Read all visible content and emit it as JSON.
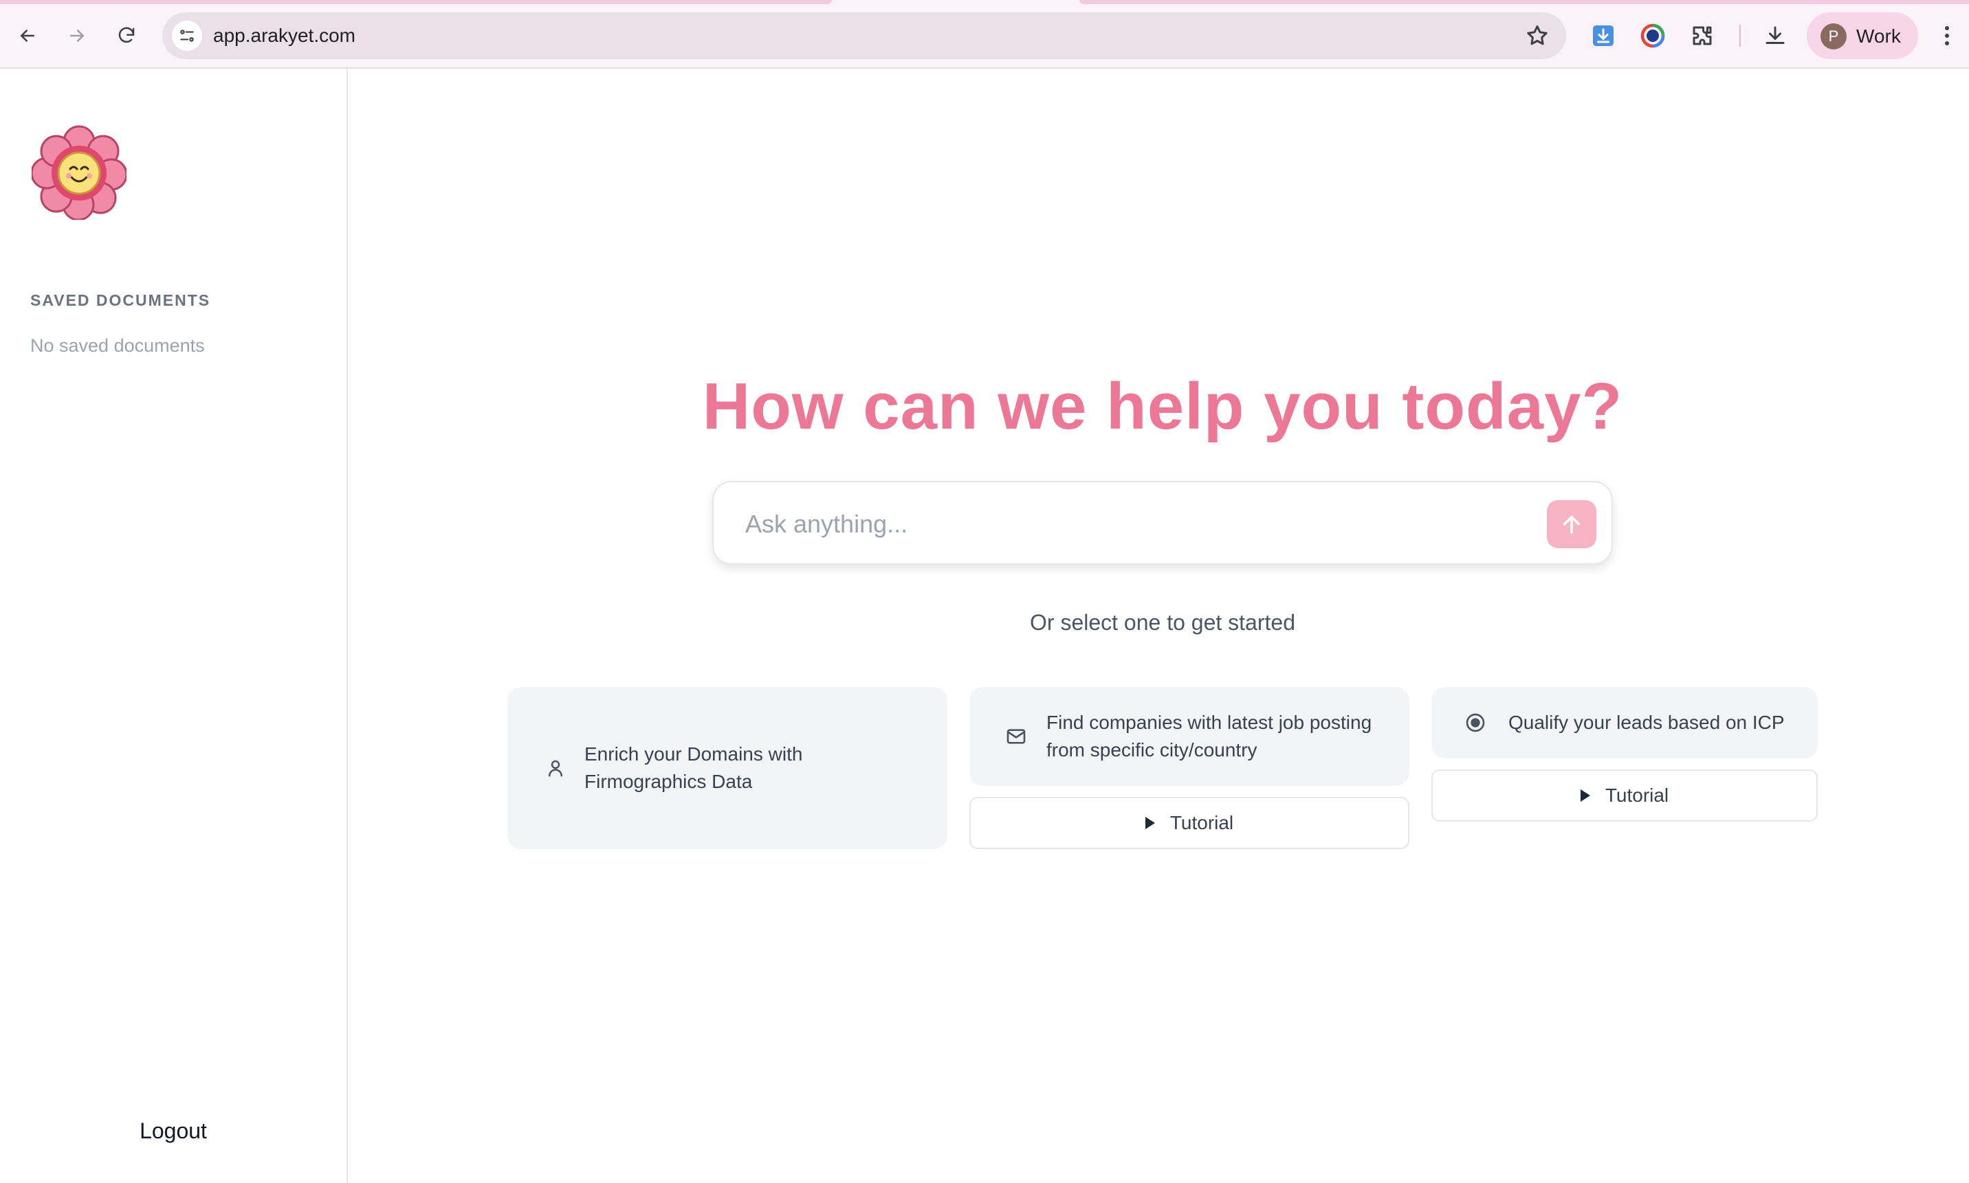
{
  "browser": {
    "url": "app.arakyet.com",
    "profile_initial": "P",
    "profile_label": "Work",
    "icons": [
      "back-icon",
      "forward-icon",
      "reload-icon",
      "site-info-icon",
      "bookmark-star-icon",
      "download-extension-icon",
      "color-extension-icon",
      "extensions-puzzle-icon",
      "downloads-icon",
      "menu-kebab-icon"
    ]
  },
  "sidebar": {
    "logo": "smiling-flower-logo",
    "section_title": "SAVED DOCUMENTS",
    "empty_text": "No saved documents",
    "logout_label": "Logout"
  },
  "main": {
    "headline": "How can we help you today?",
    "ask_placeholder": "Ask anything...",
    "subtitle": "Or select one to get started",
    "cards": [
      {
        "icon": "user-icon",
        "text_line1": "Enrich your Domains with",
        "text_line2": "Firmographics Data"
      },
      {
        "icon": "mail-icon",
        "text_line1": "Find companies with latest job posting",
        "text_line2": "from specific city/country",
        "tutorial_label": "Tutorial"
      },
      {
        "icon": "target-icon",
        "text_line1": "Qualify your leads based on ICP",
        "tutorial_label": "Tutorial"
      }
    ]
  },
  "colors": {
    "accent": "#ec7896",
    "send_button": "#f6b3c4",
    "card_bg": "#f3f4f6",
    "chrome_bg": "#fbf3f7"
  }
}
